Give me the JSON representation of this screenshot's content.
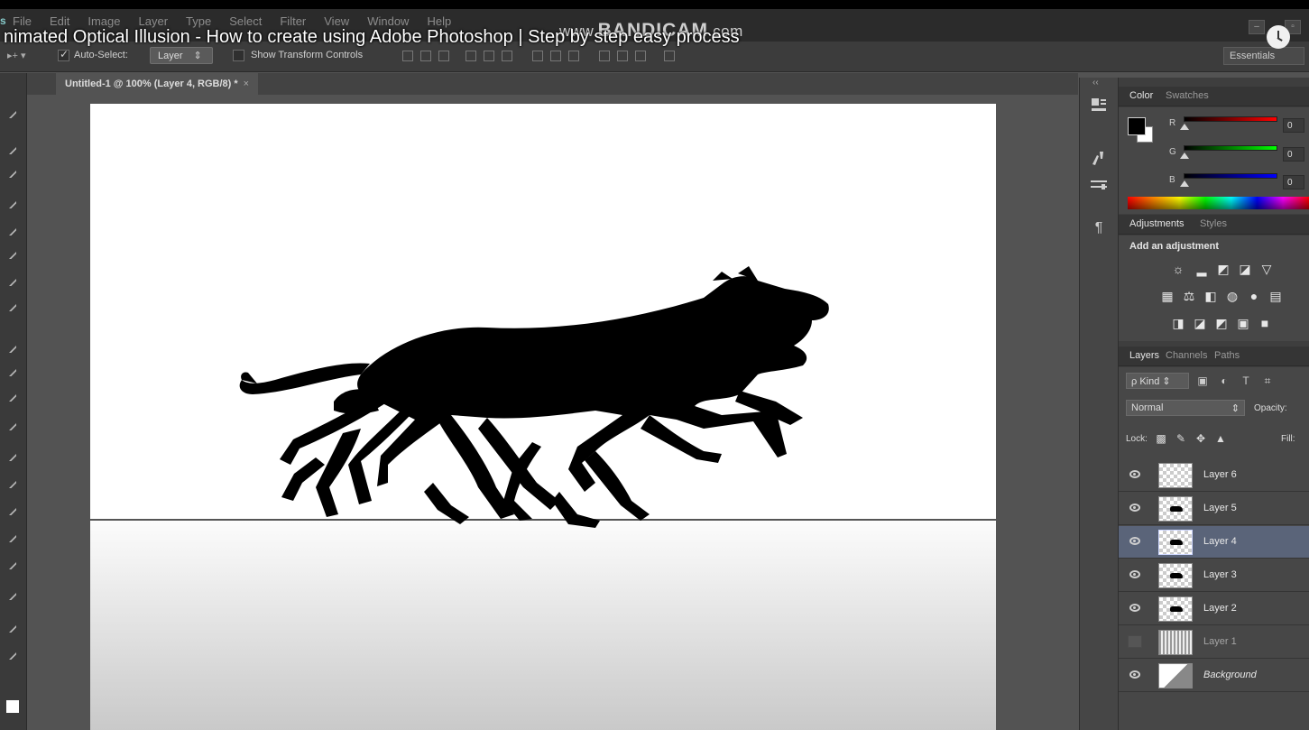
{
  "video": {
    "title": "nimated Optical Illusion - How to create using Adobe Photoshop | Step by step easy process",
    "watermark_prefix": "www.",
    "watermark_brand": "BANDICAM",
    "watermark_suffix": ".com"
  },
  "menu": {
    "items": [
      "File",
      "Edit",
      "Image",
      "Layer",
      "Type",
      "Select",
      "Filter",
      "View",
      "Window",
      "Help"
    ]
  },
  "options_bar": {
    "auto_select_label": "Auto-Select:",
    "auto_select_value": "Layer",
    "show_transform_label": "Show Transform Controls",
    "workspace": "Essentials"
  },
  "document": {
    "tab_title": "Untitled-1 @ 100% (Layer 4, RGB/8) *",
    "close": "×"
  },
  "color_panel": {
    "tabs": [
      "Color",
      "Swatches"
    ],
    "channels": [
      {
        "label": "R",
        "value": "0"
      },
      {
        "label": "G",
        "value": "0"
      },
      {
        "label": "B",
        "value": "0"
      }
    ],
    "fg": "#000000",
    "bg": "#ffffff"
  },
  "adjustments_panel": {
    "tabs": [
      "Adjustments",
      "Styles"
    ],
    "heading": "Add an adjustment",
    "icons_row1": [
      "brightness-icon",
      "levels-icon",
      "curves-icon",
      "exposure-icon",
      "vibrance-icon"
    ],
    "icons_row2": [
      "hue-saturation-icon",
      "color-balance-icon",
      "black-white-icon",
      "photo-filter-icon",
      "channel-mixer-icon",
      "color-lookup-icon"
    ],
    "icons_row3": [
      "invert-icon",
      "posterize-icon",
      "threshold-icon",
      "gradient-map-icon",
      "selective-color-icon"
    ]
  },
  "layers_panel": {
    "tabs": [
      "Layers",
      "Channels",
      "Paths"
    ],
    "kind_label": "Kind",
    "blend_mode": "Normal",
    "opacity_label": "Opacity:",
    "lock_label": "Lock:",
    "fill_label": "Fill:",
    "layers": [
      {
        "name": "Layer 6",
        "visible": true
      },
      {
        "name": "Layer 5",
        "visible": true
      },
      {
        "name": "Layer 4",
        "visible": true,
        "selected": true
      },
      {
        "name": "Layer 3",
        "visible": true
      },
      {
        "name": "Layer 2",
        "visible": true
      },
      {
        "name": "Layer 1",
        "visible": false
      },
      {
        "name": "Background",
        "visible": true
      }
    ]
  },
  "icons": {
    "collapse": "‹‹",
    "paragraph": "¶",
    "search": "ρ",
    "type": "T",
    "move": "✥",
    "lock": "🔒"
  }
}
